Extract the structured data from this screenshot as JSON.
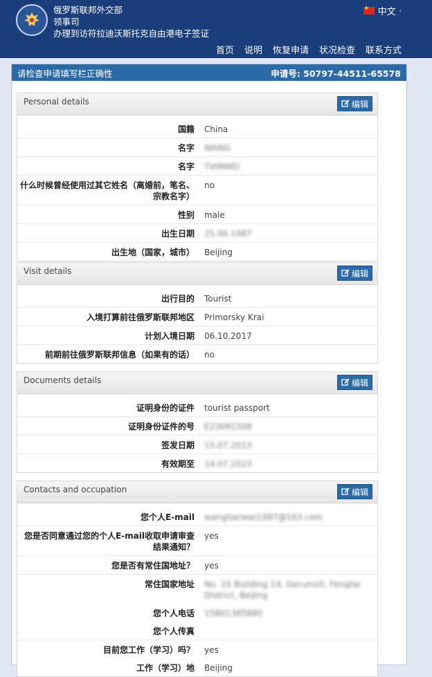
{
  "header": {
    "title_lines": [
      "俄罗斯联邦外交部",
      "领事司",
      "办理到访符拉迪沃斯托克自由港电子签证"
    ],
    "language": "中文",
    "nav": [
      "首页",
      "说明",
      "恢复申请",
      "状况检查",
      "联系方式"
    ]
  },
  "panel": {
    "title": "请检查申请填写栏正确性",
    "app_number": "申请号: 50797-44511-65578"
  },
  "edit_label": "编辑",
  "sections": [
    {
      "title": "Personal details",
      "rows": [
        {
          "label": "国籍",
          "value": "China"
        },
        {
          "label": "名字",
          "value": "WANG",
          "blur": true
        },
        {
          "label": "名字",
          "value": "TIANWEI",
          "blur": true
        },
        {
          "label": "什么时候曾经使用过其它姓名（离婚前，笔名、宗教名字）",
          "value": "no"
        },
        {
          "label": "性别",
          "value": "male"
        },
        {
          "label": "出生日期",
          "value": "25.06.1987",
          "blur": true
        },
        {
          "label": "出生地（国家，城市）",
          "value": "Beijing"
        }
      ]
    },
    {
      "title": "Visit details",
      "rows": [
        {
          "label": "出行目的",
          "value": "Tourist"
        },
        {
          "label": "入境打算前往俄罗斯联邦地区",
          "value": "Primorsky Krai"
        },
        {
          "label": "计划入境日期",
          "value": "06.10.2017"
        },
        {
          "label": "前期前往俄罗斯联邦信息（如果有的话）",
          "value": "no"
        }
      ]
    },
    {
      "title": "Documents details",
      "rows": [
        {
          "label": "证明身份的证件",
          "value": "tourist passport"
        },
        {
          "label": "证明身份证件的号",
          "value": "E23091508",
          "blur": true
        },
        {
          "label": "签发日期",
          "value": "15.07.2013",
          "blur": true
        },
        {
          "label": "有效期至",
          "value": "14.07.2023",
          "blur": true
        }
      ]
    },
    {
      "title": "Contacts and occupation",
      "rows": [
        {
          "label": "您个人E-mail",
          "value": "wangtianwei1987@163.com",
          "blur": true
        },
        {
          "label": "您是否同意通过您的个人E-mail收取申请审查结果通知？",
          "value": "yes"
        },
        {
          "label": "您是否有常住国地址？",
          "value": "yes"
        },
        {
          "label": "常住国家地址",
          "value": "No. 15 Building 14, Gecunxili, Fengtai District, Beijing",
          "blur": true,
          "noline": true
        },
        {
          "label": "您个人电话",
          "value": "15801385880",
          "blur": true,
          "noline": true
        },
        {
          "label": "您个人传真",
          "value": ""
        },
        {
          "label": "目前您工作（学习）吗？",
          "value": "yes",
          "noline": true
        },
        {
          "label": "工作（学习）地",
          "value": "Beijing",
          "noline": true
        }
      ]
    }
  ]
}
